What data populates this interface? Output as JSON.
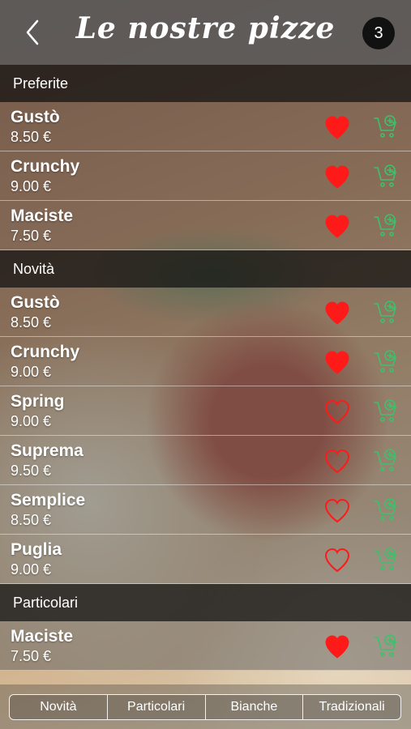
{
  "header": {
    "title": "Le nostre pizze",
    "cart_count": "3"
  },
  "colors": {
    "heart": "#ff1a1a",
    "cart": "#3cc16a"
  },
  "sections": [
    {
      "title": "Preferite",
      "items": [
        {
          "name": "Gustò",
          "price": "8.50 €",
          "favorite": true
        },
        {
          "name": "Crunchy",
          "price": "9.00 €",
          "favorite": true
        },
        {
          "name": "Maciste",
          "price": "7.50 €",
          "favorite": true
        }
      ]
    },
    {
      "title": "Novità",
      "items": [
        {
          "name": "Gustò",
          "price": "8.50 €",
          "favorite": true
        },
        {
          "name": "Crunchy",
          "price": "9.00 €",
          "favorite": true
        },
        {
          "name": "Spring",
          "price": "9.00 €",
          "favorite": false
        },
        {
          "name": "Suprema",
          "price": "9.50 €",
          "favorite": false
        },
        {
          "name": "Semplice",
          "price": "8.50 €",
          "favorite": false
        },
        {
          "name": "Puglia",
          "price": "9.00 €",
          "favorite": false
        }
      ]
    },
    {
      "title": "Particolari",
      "items": [
        {
          "name": "Maciste",
          "price": "7.50 €",
          "favorite": true
        }
      ]
    }
  ],
  "tabs": [
    {
      "label": "Novità"
    },
    {
      "label": "Particolari"
    },
    {
      "label": "Bianche"
    },
    {
      "label": "Tradizionali"
    }
  ]
}
